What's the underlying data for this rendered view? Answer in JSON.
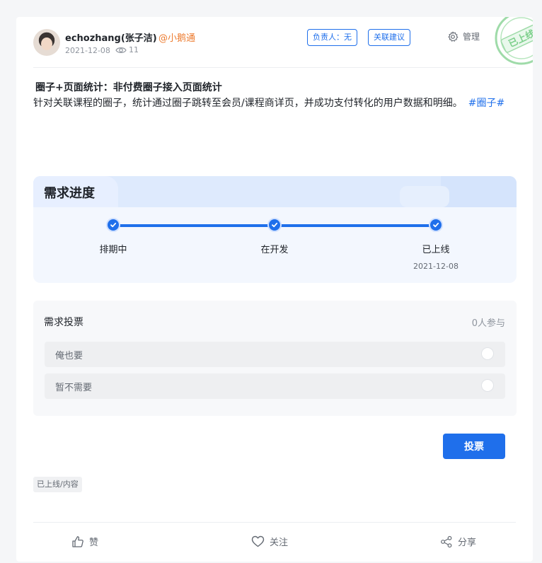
{
  "post": {
    "author": "echozhang(张子洁)",
    "mention": "@小鹅通",
    "date": "2021-12-08",
    "views": "11",
    "owner_label": "负责人：无",
    "related_label": "关联建议",
    "manage_label": "管理",
    "stamp_text": "已上线",
    "title": "圈子+页面统计：非付费圈子接入页面统计",
    "description": "针对关联课程的圈子，统计通过圈子跳转至会员/课程商详页，并成功支付转化的用户数据和明细。",
    "hashtag": "#圈子#"
  },
  "progress": {
    "title": "需求进度",
    "steps": [
      {
        "label": "排期中",
        "date": ""
      },
      {
        "label": "在开发",
        "date": ""
      },
      {
        "label": "已上线",
        "date": "2021-12-08"
      }
    ],
    "accent": "#1f6feb"
  },
  "vote": {
    "title": "需求投票",
    "participants": "0人参与",
    "options": [
      {
        "label": "俺也要"
      },
      {
        "label": "暂不需要"
      }
    ],
    "submit_label": "投票"
  },
  "status_tag": "已上线/内容",
  "actions": {
    "like": "赞",
    "follow": "关注",
    "share": "分享"
  }
}
